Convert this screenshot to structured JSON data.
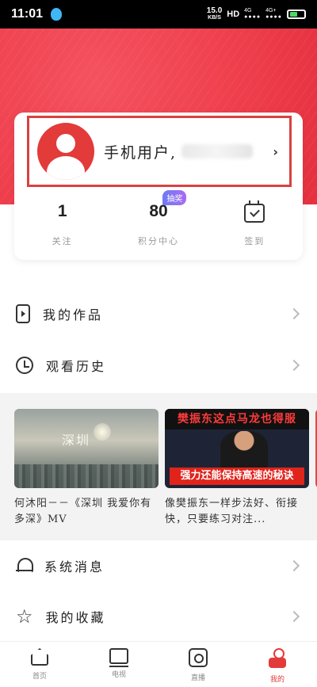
{
  "status_bar": {
    "time": "11:01",
    "net_speed": "15.0",
    "net_unit": "KB/S",
    "hd": "HD",
    "signal_1": "4G",
    "signal_2": "4G+"
  },
  "profile": {
    "username": "手机用户,",
    "stats": [
      {
        "value": "1",
        "label": "关注"
      },
      {
        "value": "80",
        "label": "积分中心",
        "badge": "抽奖"
      },
      {
        "value": "",
        "label": "签到",
        "icon": "calendar-check-icon"
      }
    ]
  },
  "menu": {
    "my_works": "我的作品",
    "watch_history": "观看历史",
    "system_messages": "系统消息",
    "my_favorites": "我的收藏"
  },
  "history": [
    {
      "title": "何沐阳－－《深圳 我爱你有多深》MV",
      "overlay": "深圳"
    },
    {
      "title": "像樊振东一样步法好、衔接快，只要练习对注...",
      "banner": "樊振东这点马龙也得服",
      "subtitle": "强力还能保持高速的秘诀"
    }
  ],
  "tabs": [
    {
      "label": "首页",
      "icon": "home-icon"
    },
    {
      "label": "电视",
      "icon": "tv-icon"
    },
    {
      "label": "直播",
      "icon": "live-icon"
    },
    {
      "label": "我的",
      "icon": "me-icon",
      "active": true
    }
  ],
  "colors": {
    "brand_red": "#e33a3a",
    "hero_red": "#ef3f4d",
    "highlight_border": "#d9413f"
  }
}
